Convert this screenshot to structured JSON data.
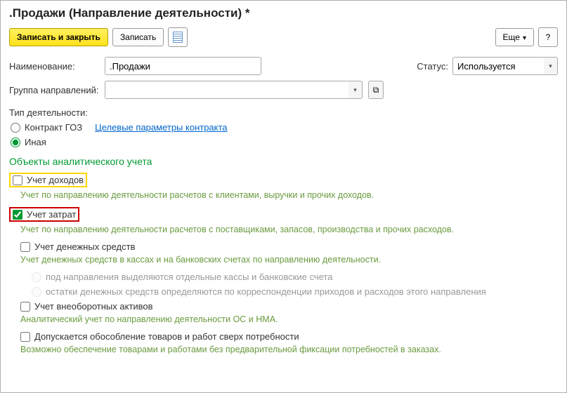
{
  "title": ".Продажи (Направление деятельности) *",
  "toolbar": {
    "save_close": "Записать и закрыть",
    "save": "Записать",
    "more": "Еще",
    "help": "?"
  },
  "fields": {
    "name_label": "Наименование:",
    "name_value": ".Продажи",
    "status_label": "Статус:",
    "status_value": "Используется",
    "group_label": "Группа направлений:",
    "group_value": "",
    "type_label": "Тип деятельности:",
    "type_goz": "Контракт ГОЗ",
    "type_goz_link": "Целевые параметры контракта",
    "type_other": "Иная"
  },
  "analytics": {
    "section_title": "Объекты аналитического учета",
    "income_label": "Учет доходов",
    "income_desc": "Учет по направлению деятельности расчетов с клиентами, выручки и прочих доходов.",
    "cost_label": "Учет затрат",
    "cost_desc": "Учет по направлению деятельности расчетов с поставщиками, запасов, производства и прочих расходов.",
    "money_label": "Учет денежных средств",
    "money_desc": "Учет денежных средств в кассах и на банковских счетах по направлению деятельности.",
    "money_sub1": "под направления выделяются отдельные кассы и банковские счета",
    "money_sub2": "остатки денежных средств определяются по корреспонденции приходов и расходов этого направления",
    "assets_label": "Учет внеоборотных активов",
    "assets_desc": "Аналитический учет по направлению деятельности ОС и НМА.",
    "goods_label": "Допускается обособление товаров и работ сверх потребности",
    "goods_desc": "Возможно обеспечение товарами и работами без предварительной фиксации потребностей в заказах."
  }
}
